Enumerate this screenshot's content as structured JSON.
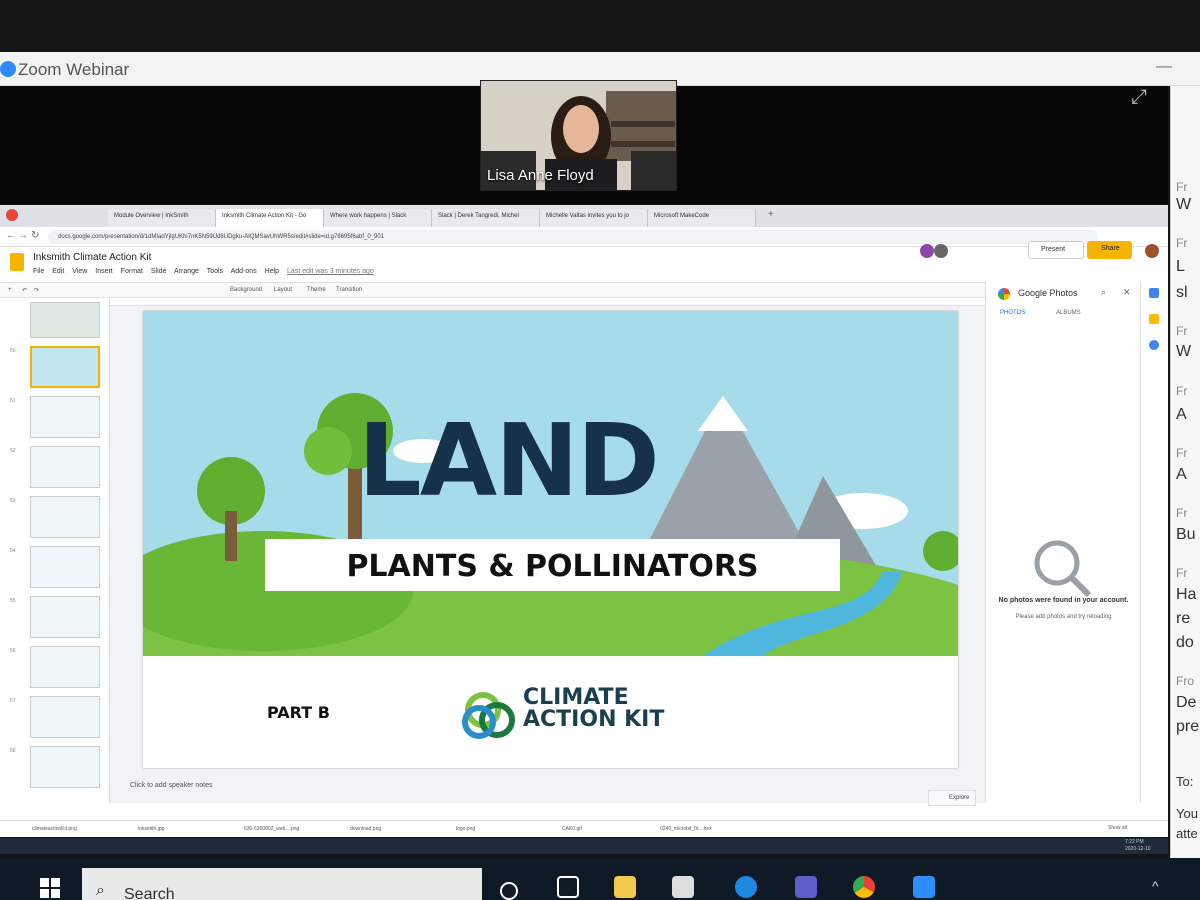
{
  "zoom": {
    "title": "Zoom Webinar",
    "presenter_name": "Lisa Anne Floyd",
    "chat_lines": [
      "Fr",
      "W",
      "Fr",
      "L",
      "sl",
      "Fr",
      "W",
      "Fr",
      "A",
      "Fr",
      "A",
      "Fr",
      "Bu",
      "Fr",
      "Ha",
      "re",
      "do",
      "Fro",
      "De",
      "pre",
      "To:",
      "You",
      "atte"
    ]
  },
  "browser": {
    "tabs": [
      "Module Overview | InkSmith",
      "Inksmith Climate Action Kit - Go",
      "Where work happens | Slack",
      "Slack | Derek Tangredi, Michel",
      "Michelle Valtas invites you to jo",
      "Microsoft MakeCode"
    ],
    "url": "docs.google.com/presentation/d/1dMIadYjlgUKhi7nK5N59Ud8UDgku-AIQMSavUhWR5s/edit#slide=id.g78695f6abf_0_901"
  },
  "slides": {
    "doc_title": "Inksmith Climate Action Kit",
    "menu": [
      "File",
      "Edit",
      "View",
      "Insert",
      "Format",
      "Slide",
      "Arrange",
      "Tools",
      "Add-ons",
      "Help"
    ],
    "last_edit": "Last edit was 3 minutes ago",
    "present_label": "Present",
    "share_label": "Share",
    "toolbar": [
      "Background",
      "Layout",
      "Theme",
      "Transition"
    ],
    "thumb_numbers": [
      "50",
      "51",
      "52",
      "53",
      "54",
      "55",
      "56",
      "57",
      "58"
    ],
    "speaker_notes": "Click to add speaker notes",
    "explore_label": "Explore"
  },
  "slide": {
    "title": "LAND",
    "subtitle": "PLANTS & POLLINATORS",
    "part": "PART B",
    "brand_line1": "CLIMATE",
    "brand_line2": "ACTION KIT",
    "colors": {
      "sky": "#9fdceb",
      "grass": "#7cc243",
      "title": "#16324a",
      "river": "#4fb7dd",
      "mountain": "#9aa1a8"
    }
  },
  "photos_panel": {
    "title": "Google Photos",
    "tab_photos": "PHOTOS",
    "tab_albums": "ALBUMS",
    "empty_title": "No photos were found in your account.",
    "empty_sub": "Please add photos and try reloading"
  },
  "downloads": {
    "items": [
      "climateactionKit.png",
      "inksmith.jpg",
      "630-6300802_web....png",
      "download.png",
      "logo.png",
      "CAK0.gif",
      "0249_microbit_fir....hex"
    ],
    "show_all": "Show all"
  },
  "system": {
    "clock_time": "7:22 PM",
    "clock_date": "2020-12-10",
    "search_label": "Search"
  }
}
